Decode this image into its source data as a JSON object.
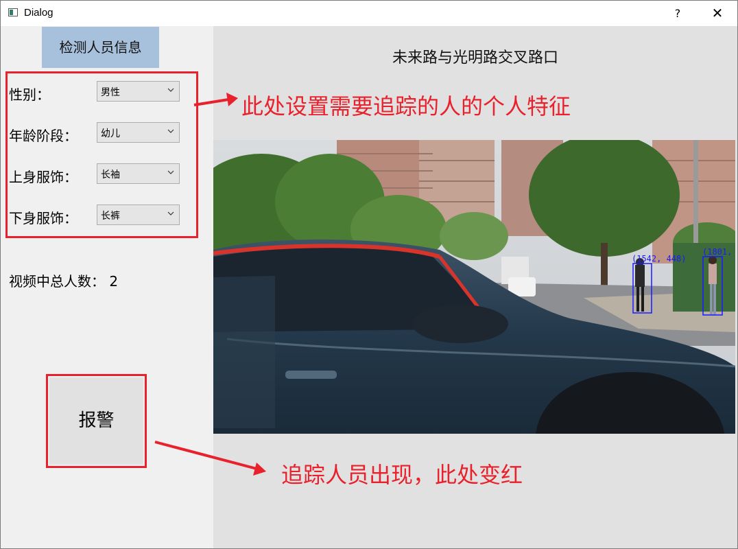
{
  "window": {
    "title": "Dialog",
    "help_label": "?",
    "close_label": "✕"
  },
  "left_panel": {
    "header": "检测人员信息",
    "fields": [
      {
        "label": "性别：",
        "value": "男性"
      },
      {
        "label": "年龄阶段：",
        "value": "幼儿"
      },
      {
        "label": "上身服饰：",
        "value": "长袖"
      },
      {
        "label": "下身服饰：",
        "value": "长裤"
      }
    ],
    "total_label": "视频中总人数：",
    "total_count": "2",
    "alarm_label": "报警"
  },
  "right_panel": {
    "title": "未来路与光明路交叉路口",
    "detections": [
      {
        "label": "(1542, 448)"
      },
      {
        "label": "(1801,"
      }
    ]
  },
  "annotations": {
    "top": "此处设置需要追踪的人的个人特征",
    "bottom": "追踪人员出现，此处变红"
  },
  "colors": {
    "annotation_red": "#e8212c",
    "header_blue": "#a7c0dc",
    "detection_blue": "#1a1aff"
  },
  "icons": [
    "app-icon",
    "help-icon",
    "close-icon",
    "chevron-down-icon"
  ]
}
